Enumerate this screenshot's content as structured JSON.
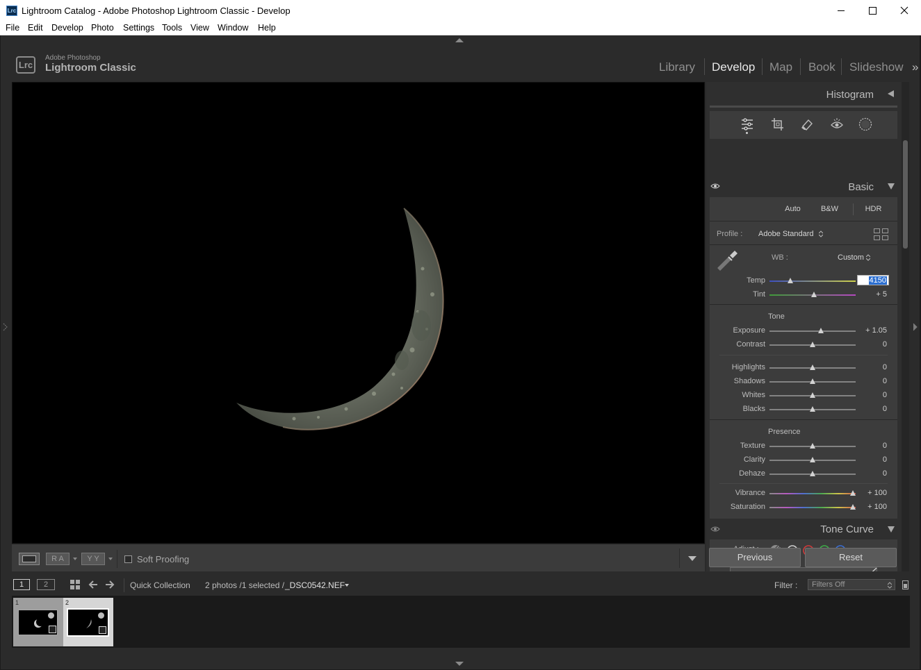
{
  "window": {
    "app_logo": "Lrc",
    "title": "Lightroom Catalog - Adobe Photoshop Lightroom Classic - Develop"
  },
  "menu": [
    "File",
    "Edit",
    "Develop",
    "Photo",
    "Settings",
    "Tools",
    "View",
    "Window",
    "Help"
  ],
  "identity": {
    "logo": "Lrc",
    "line1": "Adobe Photoshop",
    "line2": "Lightroom Classic"
  },
  "modules": [
    "Library",
    "Develop",
    "Map",
    "Book",
    "Slideshow"
  ],
  "modules_more": "»",
  "panel": {
    "histogram_title": "Histogram",
    "tools": [
      "edit-sliders-icon",
      "crop-icon",
      "healing-eraser-icon",
      "red-eye-icon",
      "masking-icon"
    ],
    "basic": {
      "title": "Basic",
      "auto": "Auto",
      "bw": "B&W",
      "hdr": "HDR",
      "profile_label": "Profile :",
      "profile_value": "Adobe Standard",
      "wb_label": "WB :",
      "wb_value": "Custom",
      "temp": {
        "label": "Temp",
        "value": "4150"
      },
      "tint": {
        "label": "Tint",
        "value": "+ 5"
      },
      "tone_title": "Tone",
      "exposure": {
        "label": "Exposure",
        "value": "+ 1.05"
      },
      "contrast": {
        "label": "Contrast",
        "value": "0"
      },
      "highlights": {
        "label": "Highlights",
        "value": "0"
      },
      "shadows": {
        "label": "Shadows",
        "value": "0"
      },
      "whites": {
        "label": "Whites",
        "value": "0"
      },
      "blacks": {
        "label": "Blacks",
        "value": "0"
      },
      "presence_title": "Presence",
      "texture": {
        "label": "Texture",
        "value": "0"
      },
      "clarity": {
        "label": "Clarity",
        "value": "0"
      },
      "dehaze": {
        "label": "Dehaze",
        "value": "0"
      },
      "vibrance": {
        "label": "Vibrance",
        "value": "+ 100"
      },
      "saturation": {
        "label": "Saturation",
        "value": "+ 100"
      }
    },
    "tone_curve": {
      "title": "Tone Curve",
      "adjust_label": "Adjust :"
    }
  },
  "toolbar": {
    "soft_proofing": "Soft Proofing",
    "ra": "R A",
    "yy": "Y Y"
  },
  "buttons": {
    "previous": "Previous",
    "reset": "Reset"
  },
  "filmstrip": {
    "screen1": "1",
    "screen2": "2",
    "source": "Quick Collection",
    "count": "2 photos /1 selected /",
    "filename": "_DSC0542.NEF",
    "filter_label": "Filter :",
    "filter_value": "Filters Off",
    "cells": [
      "1",
      "2"
    ]
  }
}
